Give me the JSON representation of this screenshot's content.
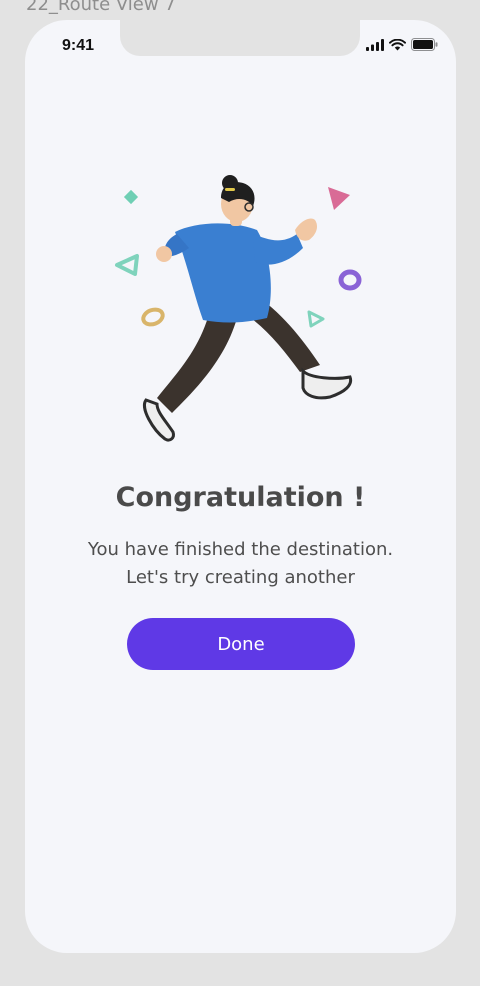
{
  "frame_label": "22_Route View 7",
  "status_bar": {
    "time": "9:41",
    "signal_icon": "cellular-signal-icon",
    "wifi_icon": "wifi-icon",
    "battery_icon": "battery-icon"
  },
  "illustration": {
    "icon": "running-person-illustration"
  },
  "content": {
    "title": "Congratulation !",
    "message_line1": "You have finished the destination.",
    "message_line2": "Let's try creating another"
  },
  "actions": {
    "done_label": "Done"
  },
  "colors": {
    "accent": "#5f39e6",
    "background": "#f5f6fa",
    "frame": "#e3e3e3"
  }
}
